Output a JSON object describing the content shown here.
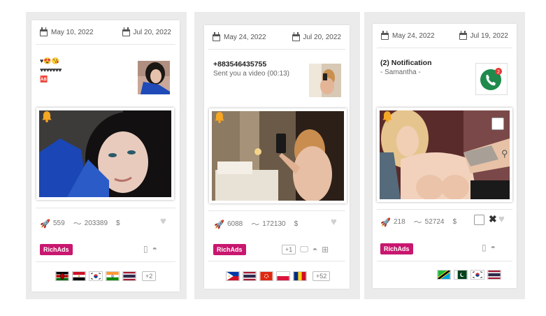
{
  "cards": [
    {
      "date_start": "May 10, 2022",
      "date_end": "Jul 20, 2022",
      "notification": {
        "line1": "♥😍😘",
        "line2": "♥♥♥♥♥♥♥",
        "line3": "🆎"
      },
      "stats": {
        "clicks": "559",
        "impressions": "203389",
        "currency": "$"
      },
      "network": "RichAds",
      "more_countries": "+2"
    },
    {
      "date_start": "May 24, 2022",
      "date_end": "Jul 20, 2022",
      "notification": {
        "title": "+883546435755",
        "subtitle": "Sent you a video (00:13)"
      },
      "stats": {
        "clicks": "6088",
        "impressions": "172130",
        "currency": "$"
      },
      "network": "RichAds",
      "more_platforms": "+1",
      "more_countries": "+52"
    },
    {
      "date_start": "May 24, 2022",
      "date_end": "Jul 19, 2022",
      "notification": {
        "title": "(2) Notification",
        "subtitle": "- Samantha -",
        "icon_badge": "2"
      },
      "stats": {
        "clicks": "218",
        "impressions": "52724",
        "currency": "$"
      },
      "network": "RichAds"
    }
  ],
  "colors": {
    "badge": "#c8176f",
    "bell": "#f5a623",
    "phone_green": "#1f8a4c"
  }
}
